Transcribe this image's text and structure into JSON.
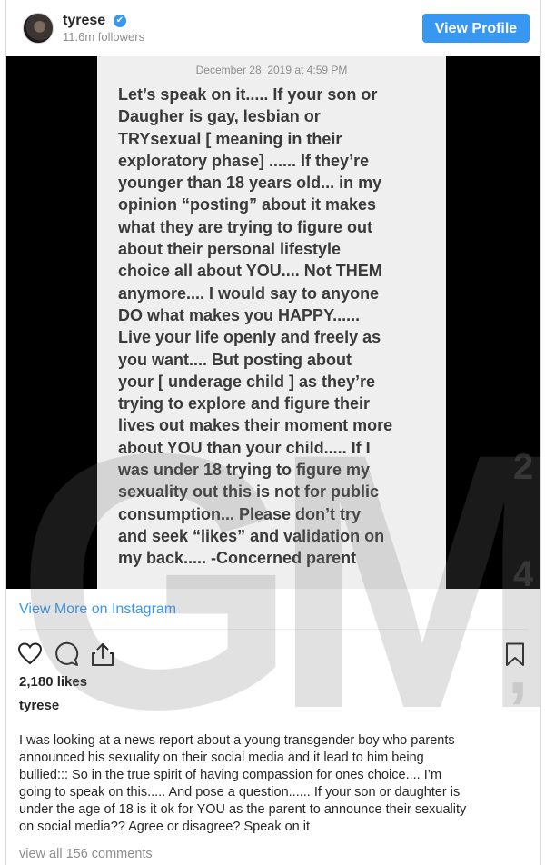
{
  "header": {
    "username": "tyrese",
    "verified_icon": "✔",
    "followers": "11.6m followers",
    "view_profile_label": "View Profile"
  },
  "media": {
    "date": "December 28, 2019 at 4:59 PM",
    "note_text": "Let’s speak on it..... If your son or\nDaugher is gay, lesbian or\nTRYsexual [ meaning in their\nexploratory phase] ......  If they’re\nyounger than 18 years old... in my\nopinion “posting” about it makes\nwhat they are trying to figure out\nabout their personal lifestyle\nchoice all about YOU.... Not THEM\nanymore.... I would say to anyone\nDO what makes you HAPPY......\nLive your life openly and freely as\nyou want....  But posting about\nyour [ underage child ] as they’re\ntrying to explore and figure their\nlives out makes their moment more\nabout YOU than your child..... If I\nwas under 18 trying to figure my\nsexuality out this is not for public\nconsumption... Please don’t try\nand seek “likes” and validation on\nmy back.....  -Concerned parent",
    "watermark": {
      "main": "GM",
      "digit_top": "2",
      "digit_bottom": "4",
      "comma": ","
    }
  },
  "view_more_label": "View More on Instagram",
  "actions": {
    "icons": [
      "heart-icon",
      "comment-icon",
      "share-icon",
      "bookmark-icon"
    ]
  },
  "likes": "2,180 likes",
  "caption": {
    "username": "tyrese",
    "text": "I was looking at a news report about a young transgender boy who parents\nannounced his sexuality on their social media and it lead to him being\nbullied::: So in the true spirit of having compassion for ones choice.... I’m\ngoing to speak on this..... And pose a question...... If your son or daughter is\nunder the age of 18 is it ok for YOU as the parent to announce their sexuality\non social media?? Agree or disagree? Speak on it"
  },
  "comments_link": "view all 156 comments",
  "colors": {
    "accent": "#3897f0",
    "muted": "#8e8e8e",
    "text": "#262626",
    "note_background": "#efefef"
  }
}
